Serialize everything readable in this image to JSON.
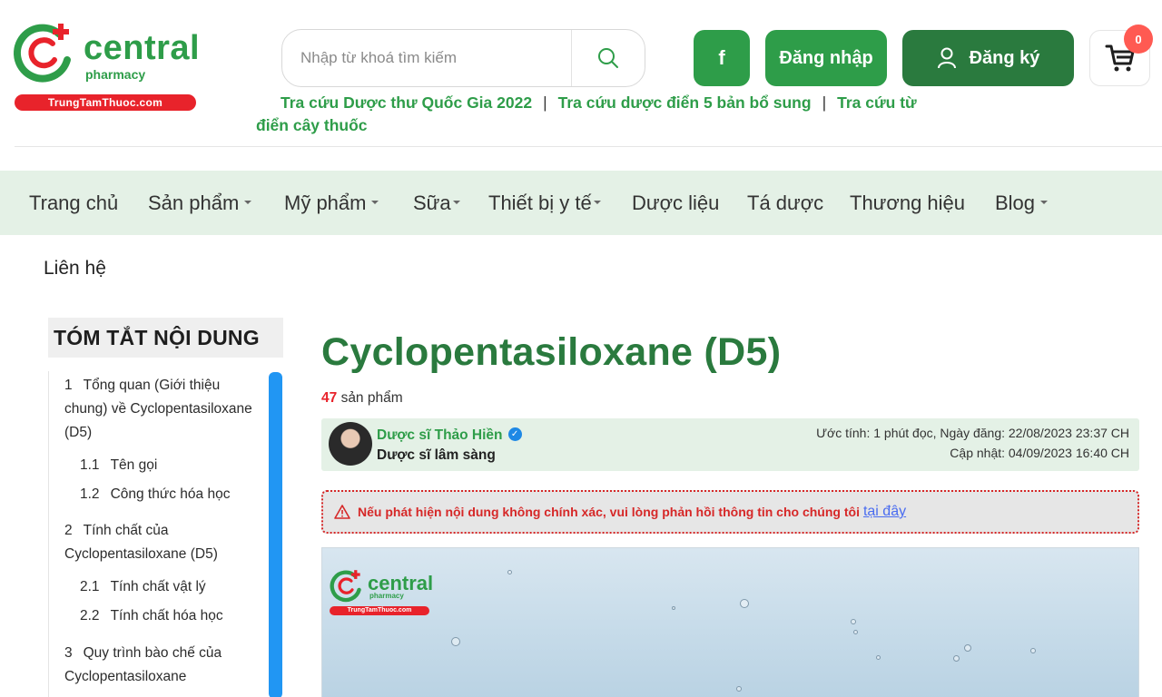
{
  "brand": {
    "name": "central",
    "sub": "pharmacy",
    "band": "TrungTamThuoc.com"
  },
  "search": {
    "placeholder": "Nhập từ khoá tìm kiếm"
  },
  "header": {
    "facebook": "f",
    "login": "Đăng nhập",
    "register": "Đăng ký",
    "cart_count": "0"
  },
  "quick_links": [
    "Tra cứu Dược thư Quốc Gia 2022",
    "Tra cứu dược điển 5 bản bổ sung",
    "Tra cứu từ điển cây thuốc"
  ],
  "quick_links_sep": "|",
  "nav": [
    {
      "label": "Trang chủ"
    },
    {
      "label": "Sản phẩm"
    },
    {
      "label": "Mỹ phẩm"
    },
    {
      "label": "Sữa"
    },
    {
      "label": "Thiết bị y tế"
    },
    {
      "label": "Dược liệu"
    },
    {
      "label": "Tá dược"
    },
    {
      "label": "Thương hiệu"
    },
    {
      "label": "Blog"
    }
  ],
  "contact": "Liên hệ",
  "toc": {
    "title": "TÓM TẮT NỘI DUNG",
    "items": [
      {
        "num": "1",
        "text": "Tổng quan (Giới thiệu chung) về Cyclopentasiloxane (D5)"
      },
      {
        "num": "1.1",
        "text": "Tên gọi"
      },
      {
        "num": "1.2",
        "text": "Công thức hóa học"
      },
      {
        "num": "2",
        "text": "Tính chất của Cyclopentasiloxane (D5)"
      },
      {
        "num": "2.1",
        "text": "Tính chất vật lý"
      },
      {
        "num": "2.2",
        "text": "Tính chất hóa học"
      },
      {
        "num": "3",
        "text": "Quy trình bào chế của Cyclopentasiloxane"
      }
    ]
  },
  "article": {
    "title": "Cyclopentasiloxane (D5)",
    "product_count": "47",
    "product_label": "sản phẩm",
    "author_name": "Dược sĩ Thảo Hiền",
    "author_role": "Dược sĩ lâm sàng",
    "meta_read": "Ước tính: 1 phút đọc, Ngày đăng: 22/08/2023 23:37 CH",
    "meta_updated": "Cập nhật: 04/09/2023 16:40 CH",
    "warning": "Nếu phát hiện nội dung không chính xác, vui lòng phản hồi thông tin cho chúng tôi",
    "warning_link": "tại đây"
  },
  "colors": {
    "brand_green": "#2e9d49",
    "dark_green": "#2a7a3e",
    "nav_bg": "#e4f1e6",
    "red": "#e8232b",
    "toc_scroll": "#2196f3"
  }
}
